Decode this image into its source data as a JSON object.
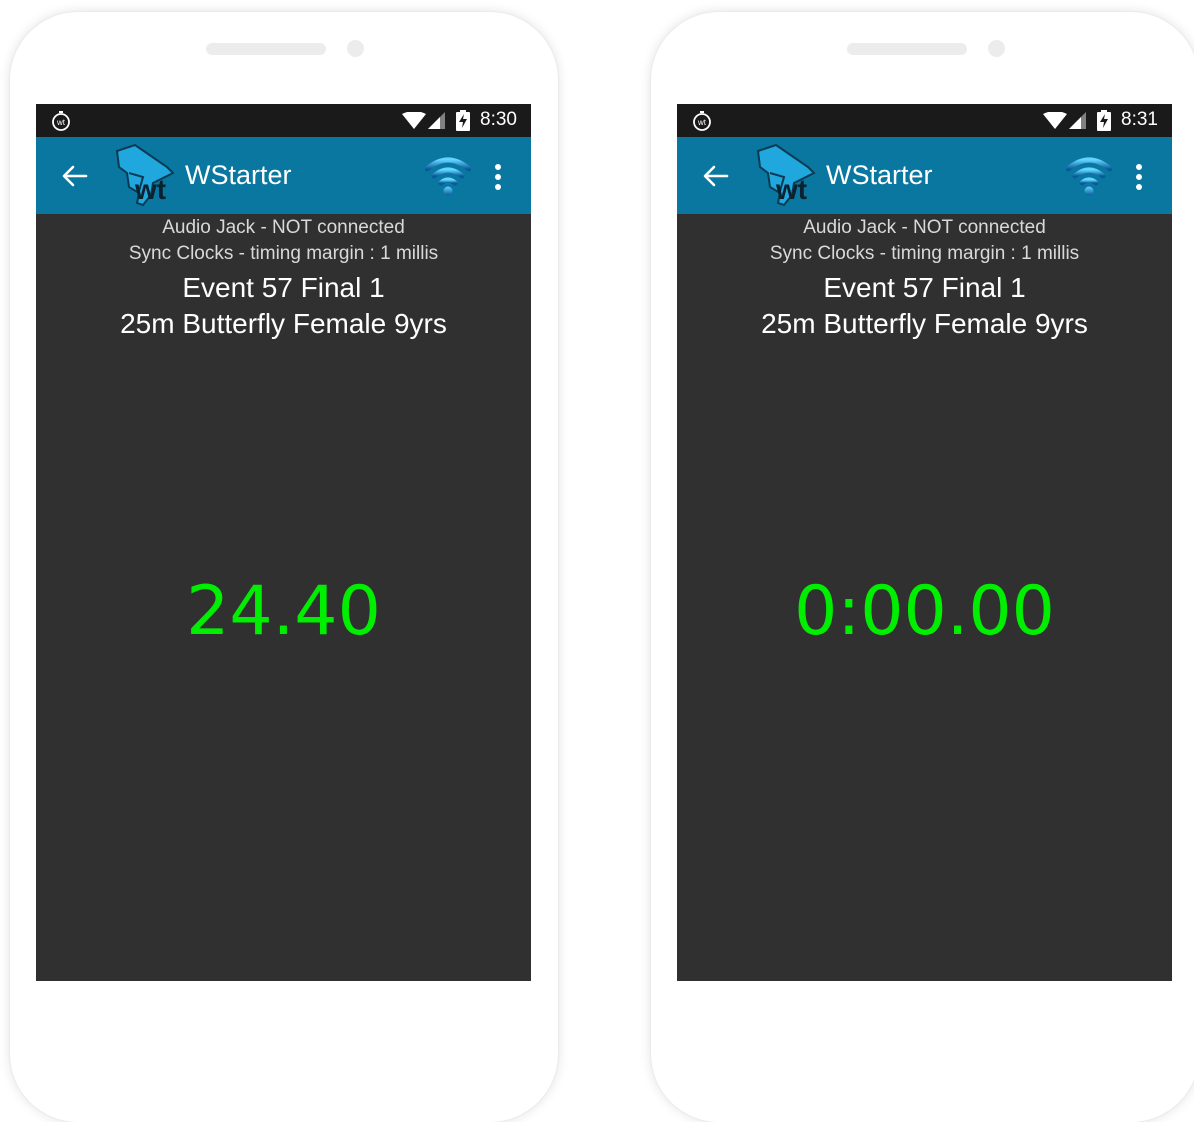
{
  "phones": [
    {
      "status_time": "8:30",
      "app_title": "WStarter",
      "audio_status": "Audio Jack - NOT connected",
      "sync_status": "Sync Clocks - timing margin : 1 millis",
      "event_line1": "Event 57 Final 1",
      "event_line2": "25m Butterfly Female 9yrs",
      "timer": "24.40"
    },
    {
      "status_time": "8:31",
      "app_title": "WStarter",
      "audio_status": "Audio Jack - NOT connected",
      "sync_status": "Sync Clocks - timing margin : 1 millis",
      "event_line1": "Event 57 Final 1",
      "event_line2": "25m Butterfly Female 9yrs",
      "timer": "0:00.00"
    }
  ],
  "logo_text": "wt",
  "status_icon_text": "wt",
  "icons": {
    "back": "arrow-left-icon",
    "logo": "starter-pistol-logo-icon",
    "wifi_status": "wifi-icon",
    "menu": "more-vertical-icon",
    "statusbar_app": "stopwatch-icon",
    "statusbar_wifi": "wifi-signal-icon",
    "statusbar_cell": "cell-signal-icon",
    "statusbar_battery": "battery-charging-icon"
  },
  "colors": {
    "appbar": "#0a77a0",
    "screen_bg": "#303030",
    "timer_green": "#00ee00",
    "statusbar": "#1a1a1a"
  }
}
